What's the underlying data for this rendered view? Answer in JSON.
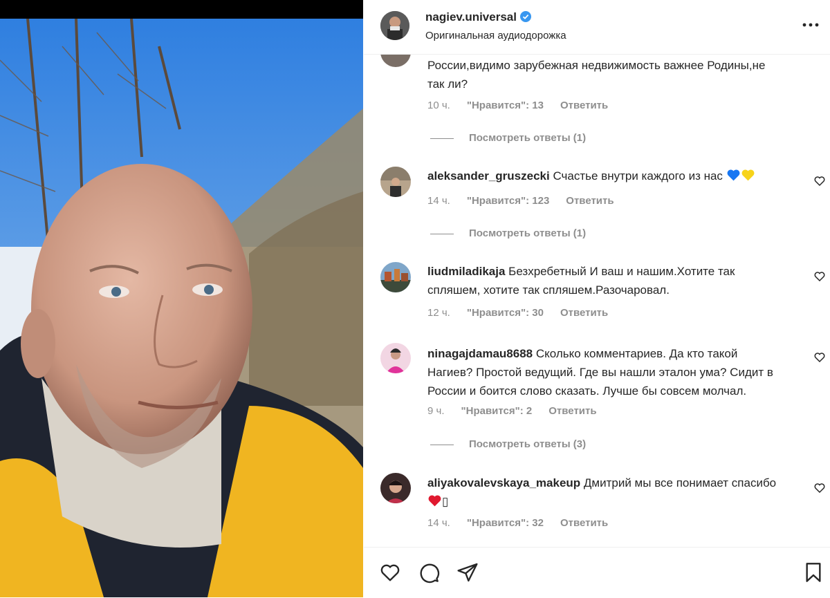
{
  "post": {
    "username": "nagiev.universal",
    "audio": "Оригинальная аудиодорожка"
  },
  "comments": [
    {
      "text": "России,видимо зарубежная недвижимость важнее Родины,не так ли?",
      "time": "10 ч.",
      "likes": "\"Нравится\": 13",
      "reply": "Ответить",
      "view_replies": "Посмотреть ответы (1)"
    },
    {
      "username": "aleksander_gruszecki",
      "text": "Счастье внутри каждого из нас",
      "emojis": [
        "blue-heart",
        "yellow-heart"
      ],
      "time": "14 ч.",
      "likes": "\"Нравится\": 123",
      "reply": "Ответить",
      "view_replies": "Посмотреть ответы (1)"
    },
    {
      "username": "liudmiladikaja",
      "text": "Безхребетный И ваш и нашим.Хотите так спляшем, хотите так спляшем.Разочаровал.",
      "time": "12 ч.",
      "likes": "\"Нравится\": 30",
      "reply": "Ответить"
    },
    {
      "username": "ninagajdamau8688",
      "text": "Сколько комментариев. Да кто такой Нагиев? Простой ведущий. Где вы нашли эталон ума? Сидит в России и боится слово сказать. Лучше бы совсем молчал.",
      "time": "9 ч.",
      "likes": "\"Нравится\": 2",
      "reply": "Ответить",
      "view_replies": "Посмотреть ответы (3)"
    },
    {
      "username": "aliyakovalevskaya_makeup",
      "text": "Дмитрий мы все понимает спасибо",
      "text_tail": "▯",
      "emojis": [
        "red-heart"
      ],
      "time": "14 ч.",
      "likes": "\"Нравится\": 32",
      "reply": "Ответить"
    }
  ],
  "colors": {
    "verified": "#3897f0",
    "muted": "#8e8e8e",
    "text": "#262626"
  },
  "icons": [
    "heart-icon",
    "comment-icon",
    "share-icon",
    "bookmark-icon",
    "more-icon",
    "verified-icon"
  ]
}
